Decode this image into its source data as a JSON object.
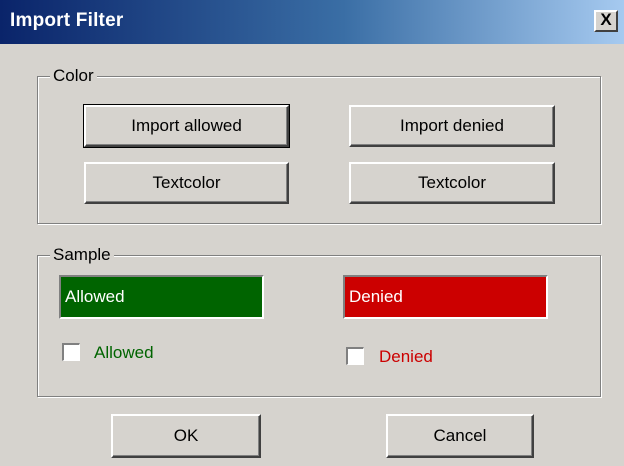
{
  "window": {
    "title": "Import Filter",
    "close_symbol": "X"
  },
  "color_group": {
    "label": "Color",
    "import_allowed": "Import allowed",
    "import_denied": "Import denied",
    "textcolor_left": "Textcolor",
    "textcolor_right": "Textcolor"
  },
  "sample_group": {
    "label": "Sample",
    "allowed_box": {
      "text": "Allowed",
      "bg_color": "#006400",
      "text_color": "#ffffff"
    },
    "denied_box": {
      "text": "Denied",
      "bg_color": "#cc0000",
      "text_color": "#ffffff"
    },
    "allowed_checkbox": {
      "label": "Allowed",
      "checked": false,
      "text_color": "#006400"
    },
    "denied_checkbox": {
      "label": "Denied",
      "checked": false,
      "text_color": "#cc0000"
    }
  },
  "footer": {
    "ok": "OK",
    "cancel": "Cancel"
  }
}
